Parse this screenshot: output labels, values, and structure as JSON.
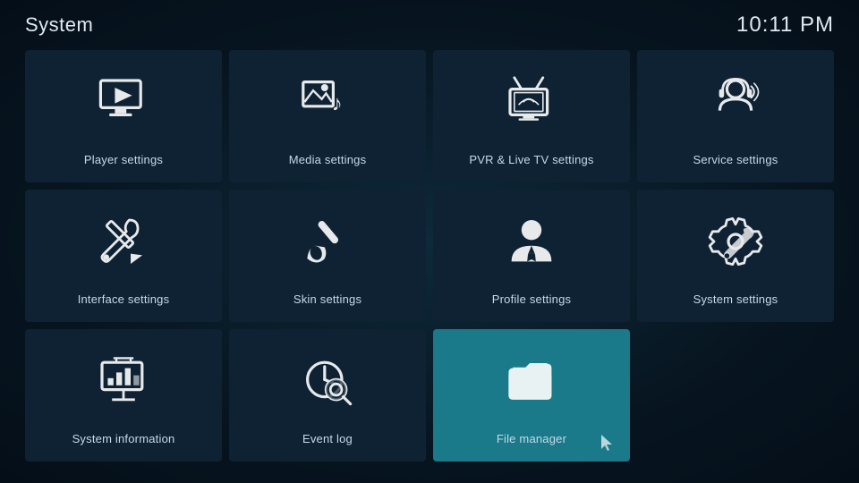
{
  "header": {
    "title": "System",
    "time": "10:11 PM"
  },
  "tiles": [
    {
      "id": "player-settings",
      "label": "Player settings",
      "icon": "player",
      "active": false
    },
    {
      "id": "media-settings",
      "label": "Media settings",
      "icon": "media",
      "active": false
    },
    {
      "id": "pvr-settings",
      "label": "PVR & Live TV settings",
      "icon": "pvr",
      "active": false
    },
    {
      "id": "service-settings",
      "label": "Service settings",
      "icon": "service",
      "active": false
    },
    {
      "id": "interface-settings",
      "label": "Interface settings",
      "icon": "interface",
      "active": false
    },
    {
      "id": "skin-settings",
      "label": "Skin settings",
      "icon": "skin",
      "active": false
    },
    {
      "id": "profile-settings",
      "label": "Profile settings",
      "icon": "profile",
      "active": false
    },
    {
      "id": "system-settings",
      "label": "System settings",
      "icon": "system",
      "active": false
    },
    {
      "id": "system-information",
      "label": "System information",
      "icon": "sysinfo",
      "active": false
    },
    {
      "id": "event-log",
      "label": "Event log",
      "icon": "eventlog",
      "active": false
    },
    {
      "id": "file-manager",
      "label": "File manager",
      "icon": "filemanager",
      "active": true
    },
    {
      "id": "empty",
      "label": "",
      "icon": "none",
      "active": false
    }
  ]
}
